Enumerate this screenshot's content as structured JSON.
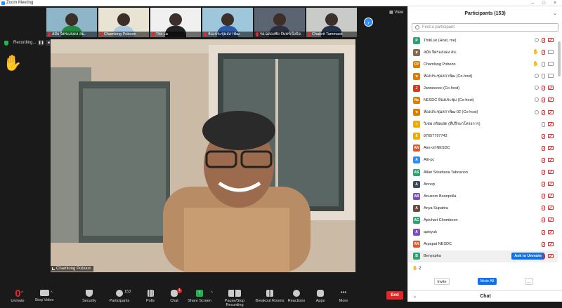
{
  "window": {
    "title": "Zoom Meeting",
    "controls": [
      "–",
      "□",
      "×"
    ]
  },
  "thumbnails": [
    {
      "name": "สมัย จิตรแสงดง สม.",
      "muted": true,
      "bg": "#8fb5c9",
      "shirt": "#1f8a3e"
    },
    {
      "name": "Chamlong Poboon",
      "muted": true,
      "bg": "#e9e3d4",
      "shirt": "#a9c7e0"
    },
    {
      "name": "Thit La",
      "muted": true,
      "bg": "#f0f0f0",
      "shirt": "#222222"
    },
    {
      "name": "ห้องประชุมสภาพัฒ",
      "muted": true,
      "bg": "#9fc7dc",
      "shirt": "#2b5ba8"
    },
    {
      "name": "รอ.ฉลองชัย จันทร์เป็งนิจ",
      "muted": true,
      "bg": "#5b6470",
      "shirt": "#2a3040"
    },
    {
      "name": "Chaikrit Tammasit",
      "muted": true,
      "bg": "#c9cbc8",
      "shirt": "#22324a"
    }
  ],
  "view_label": "View",
  "recording": {
    "label": "Recording..."
  },
  "hand_icon": "✋",
  "speaker_name": "Chamlong Poboon",
  "toolbar": {
    "unmute": "Unmute",
    "stop_video": "Stop Video",
    "security": "Security",
    "participants": "Participants",
    "participants_count": "153",
    "polls": "Polls",
    "chat": "Chat",
    "chat_badge": "1",
    "share_screen": "Share Screen",
    "record": "Pause/Stop Recording",
    "breakout": "Breakout Rooms",
    "reactions": "Reactions",
    "apps": "Apps",
    "more": "More",
    "end": "End"
  },
  "panel": {
    "title": "Participants (153)",
    "find_placeholder": "Find a participant",
    "participants": [
      {
        "initial": "P",
        "color": "#2aa56f",
        "name": "ThitiLuk (Host, me)",
        "hand": false,
        "mic": "muted",
        "cam": "muted",
        "shield": true
      },
      {
        "initial": "ส",
        "color": "#8a6a4f",
        "name": "สมัย จิตรแสงดง สม.",
        "hand": true,
        "mic": "muted",
        "cam": "on"
      },
      {
        "initial": "CP",
        "color": "#e07b00",
        "name": "Chamlong Poboon",
        "hand": true,
        "mic": "on",
        "cam": "on"
      },
      {
        "initial": "ห",
        "color": "#e07b00",
        "name": "ห้องประชุมสภาพัฒ (Co-host)",
        "hand": false,
        "mic": "on",
        "cam": "on",
        "shield": true
      },
      {
        "initial": "J",
        "color": "#d9381e",
        "name": "Janneecoc (Co-host)",
        "hand": false,
        "mic": "muted",
        "cam": "off",
        "shield": true
      },
      {
        "initial": "Ne",
        "color": "#e07b00",
        "name": "NESDC ห้องประชุม (Co-host)",
        "hand": false,
        "mic": "muted",
        "cam": "off",
        "shield": true
      },
      {
        "initial": "ห",
        "color": "#e07b00",
        "name": "ห้องประชุมสภาพัฒ-02 (Co-host)",
        "hand": false,
        "mic": "muted",
        "cam": "off",
        "shield": true
      },
      {
        "initial": "ว",
        "color": "#f2a900",
        "name": "วิเชษ สร้อยสด (ที่ปรึกษาโครงการ)",
        "hand": false,
        "mic": "on",
        "cam": "off"
      },
      {
        "initial": "8",
        "color": "#f2a900",
        "name": "87657797742",
        "hand": false,
        "mic": "muted",
        "cam": "off"
      },
      {
        "initial": "AN",
        "color": "#e0582b",
        "name": "Aim-oll NESDC",
        "hand": false,
        "mic": "muted",
        "cam": "off"
      },
      {
        "initial": "A",
        "color": "#2d8cff",
        "name": "Alit-pc",
        "hand": false,
        "mic": "muted",
        "cam": "off"
      },
      {
        "initial": "AS",
        "color": "#2aa56f",
        "name": "Allan Srirattana Tabcanon",
        "hand": false,
        "mic": "muted",
        "cam": "off"
      },
      {
        "initial": "A",
        "color": "#3d4a5c",
        "name": "Annop",
        "hand": false,
        "mic": "muted",
        "cam": "off"
      },
      {
        "initial": "AB",
        "color": "#7b4fbf",
        "name": "Anusorn Boonpolla",
        "hand": false,
        "mic": "muted",
        "cam": "off"
      },
      {
        "initial": "A",
        "color": "#6d4a3a",
        "name": "Anya Supattra",
        "hand": false,
        "mic": "muted",
        "cam": "off"
      },
      {
        "initial": "AC",
        "color": "#2aa56f",
        "name": "Apichart Chomboon",
        "hand": false,
        "mic": "muted",
        "cam": "off"
      },
      {
        "initial": "A",
        "color": "#7b4fbf",
        "name": "apinyuk",
        "hand": false,
        "mic": "muted",
        "cam": "off"
      },
      {
        "initial": "AN",
        "color": "#e0582b",
        "name": "Arpapat NESDC",
        "hand": false,
        "mic": "muted",
        "cam": "off"
      },
      {
        "initial": "B",
        "color": "#2aa56f",
        "name": "Benyapha",
        "hand": false,
        "mic": "muted",
        "cam": "off",
        "ask": true
      }
    ],
    "ask_label": "Ask to Unmute",
    "hand_count": "2",
    "invite": "Invite",
    "mute_all": "Mute All",
    "more": "...",
    "chat_title": "Chat"
  }
}
